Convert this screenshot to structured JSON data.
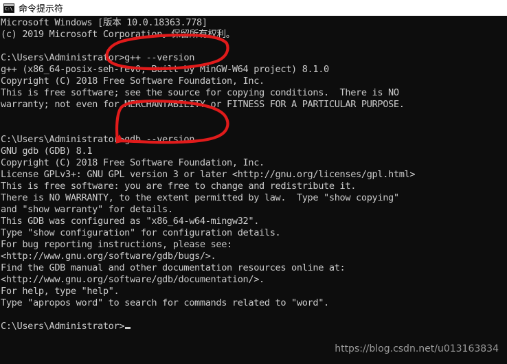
{
  "window": {
    "title": "命令提示符",
    "icon": "command-prompt-icon",
    "icon_glyph": "C:\\",
    "titlebar_bg": "#ffffff",
    "console_bg": "#0d0d0d",
    "console_fg": "#cccccc"
  },
  "console": {
    "lines": [
      "Microsoft Windows [版本 10.0.18363.778]",
      "(c) 2019 Microsoft Corporation。保留所有权利。",
      "",
      "C:\\Users\\Administrator>g++ --version",
      "g++ (x86_64-posix-seh-rev0, Built by MinGW-W64 project) 8.1.0",
      "Copyright (C) 2018 Free Software Foundation, Inc.",
      "This is free software; see the source for copying conditions.  There is NO",
      "warranty; not even for MERCHANTABILITY or FITNESS FOR A PARTICULAR PURPOSE.",
      "",
      "",
      "C:\\Users\\Administrator>gdb --version",
      "GNU gdb (GDB) 8.1",
      "Copyright (C) 2018 Free Software Foundation, Inc.",
      "License GPLv3+: GNU GPL version 3 or later <http://gnu.org/licenses/gpl.html>",
      "This is free software: you are free to change and redistribute it.",
      "There is NO WARRANTY, to the extent permitted by law.  Type \"show copying\"",
      "and \"show warranty\" for details.",
      "This GDB was configured as \"x86_64-w64-mingw32\".",
      "Type \"show configuration\" for configuration details.",
      "For bug reporting instructions, please see:",
      "<http://www.gnu.org/software/gdb/bugs/>.",
      "Find the GDB manual and other documentation resources online at:",
      "<http://www.gnu.org/software/gdb/documentation/>.",
      "For help, type \"help\".",
      "Type \"apropos word\" to search for commands related to \"word\".",
      "",
      "C:\\Users\\Administrator>"
    ],
    "prompt_value": "C:\\Users\\Administrator>",
    "cursor_visible": true
  },
  "annotations": {
    "color": "#e01b1b",
    "items": [
      {
        "name": "gpp-version-command-circle",
        "shape": "ellipse",
        "highlights": "C:\\Users\\Administrator>g++ --version"
      },
      {
        "name": "gdb-version-command-circle",
        "shape": "ellipse-with-tail",
        "highlights": "C:\\Users\\Administrator>gdb --version"
      }
    ]
  },
  "watermark": {
    "text": "https://blog.csdn.net/u013163834",
    "color": "#9a9a9a"
  }
}
